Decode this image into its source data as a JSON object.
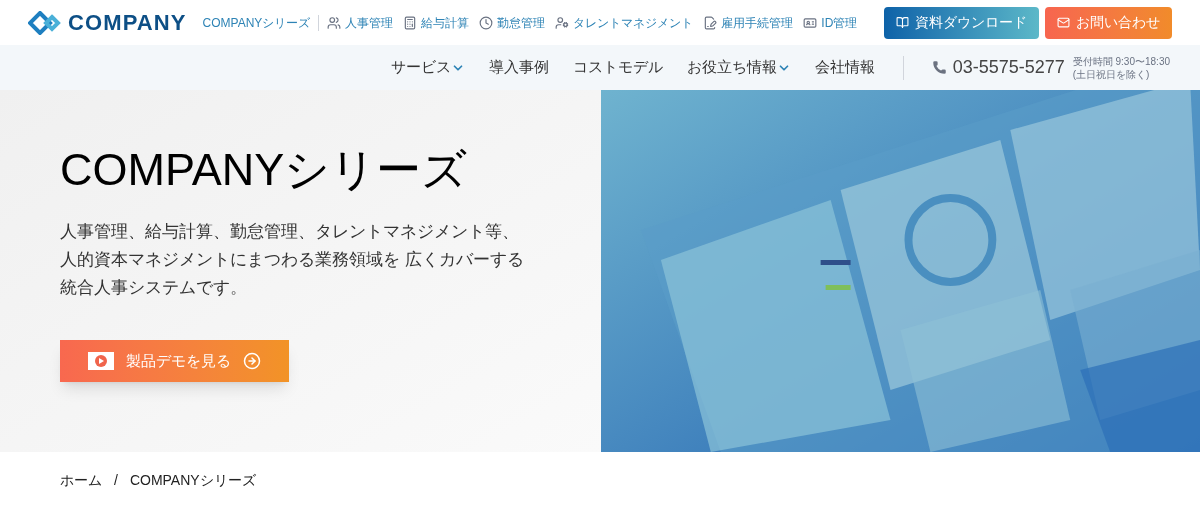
{
  "header": {
    "logo": "COMPANY",
    "series_link": "COMPANYシリーズ",
    "products": [
      {
        "label": "人事管理"
      },
      {
        "label": "給与計算"
      },
      {
        "label": "勤怠管理"
      },
      {
        "label": "タレントマネジメント"
      },
      {
        "label": "雇用手続管理"
      },
      {
        "label": "ID管理"
      }
    ],
    "buttons": [
      {
        "kind": "download",
        "label": "資料ダウンロード"
      },
      {
        "kind": "contact",
        "label": "お問い合わせ"
      }
    ]
  },
  "nav": {
    "items": [
      {
        "label": "サービス",
        "dropdown": true
      },
      {
        "label": "導入事例",
        "dropdown": false
      },
      {
        "label": "コストモデル",
        "dropdown": false
      },
      {
        "label": "お役立ち情報",
        "dropdown": true
      },
      {
        "label": "会社情報",
        "dropdown": false
      }
    ],
    "phone": "03-5575-5277",
    "hours": "受付時間 9:30〜18:30",
    "hours_note": "(土日祝日を除く)"
  },
  "hero": {
    "title": "COMPANYシリーズ",
    "lines": [
      "人事管理、給与計算、勤怠管理、タレントマネジメント等、",
      "人的資本マネジメントにまつわる業務領域を 広くカバーする",
      "統合人事システムです。"
    ],
    "cta": "製品デモを見る"
  },
  "breadcrumb": {
    "separator": "/",
    "items": [
      "ホーム",
      "COMPANYシリーズ"
    ]
  }
}
